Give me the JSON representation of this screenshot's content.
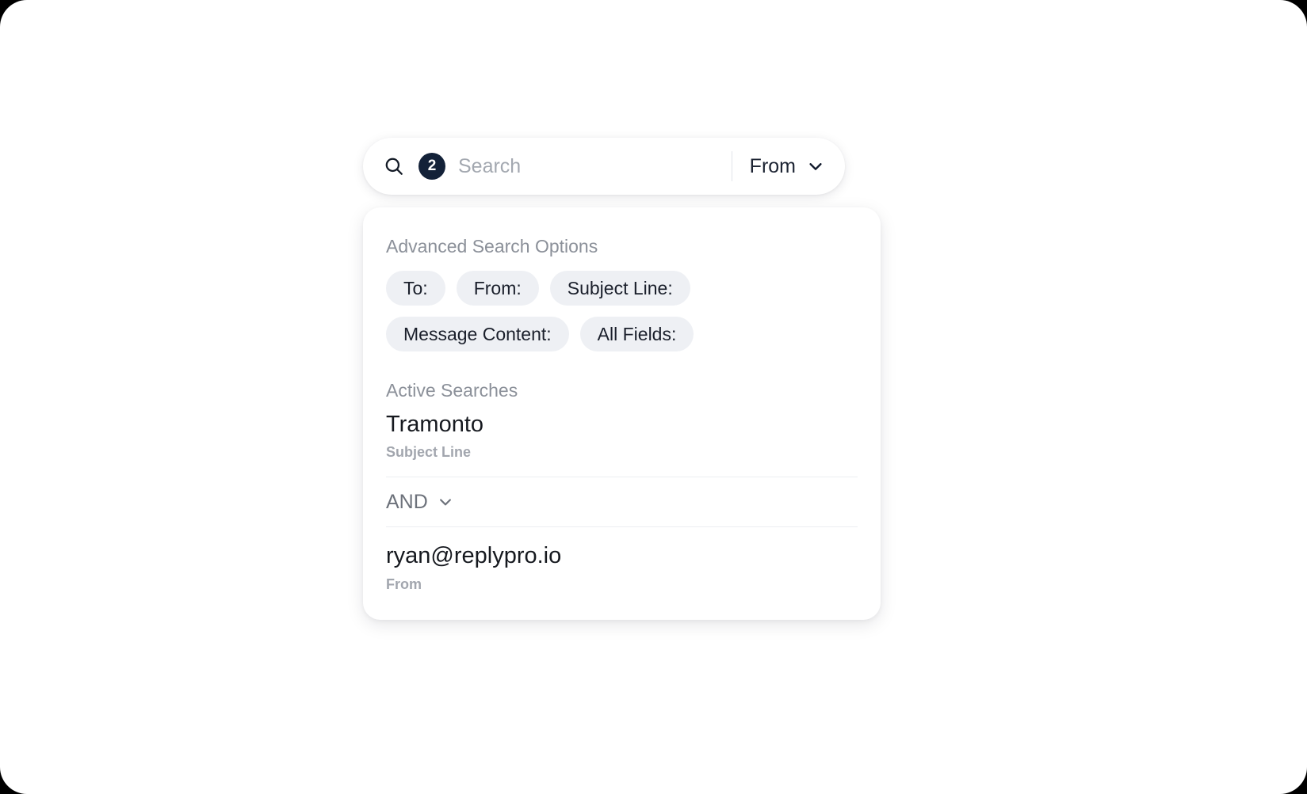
{
  "search_bar": {
    "icon": "search-icon",
    "badge_count": "2",
    "input_value": "",
    "input_placeholder": "Search",
    "field_selector": {
      "label": "From",
      "icon": "chevron-down-icon"
    }
  },
  "panel": {
    "advanced_title": "Advanced Search Options",
    "option_chips": [
      {
        "label": "To:"
      },
      {
        "label": "From:"
      },
      {
        "label": "Subject Line:"
      },
      {
        "label": "Message Content:"
      },
      {
        "label": "All Fields:"
      }
    ],
    "active_title": "Active Searches",
    "active_searches": [
      {
        "value": "Tramonto",
        "field": "Subject Line"
      },
      {
        "value": "ryan@replypro.io",
        "field": "From"
      }
    ],
    "operator": {
      "label": "AND",
      "icon": "chevron-down-icon"
    }
  },
  "colors": {
    "badge_background": "#132138",
    "badge_text": "#ffffff",
    "chip_background": "#eef0f4",
    "chip_text": "#1a1f2b",
    "muted_text": "#8b9099",
    "primary_text": "#16191f",
    "page_background": "#ffffff",
    "frame_background": "#000000"
  }
}
